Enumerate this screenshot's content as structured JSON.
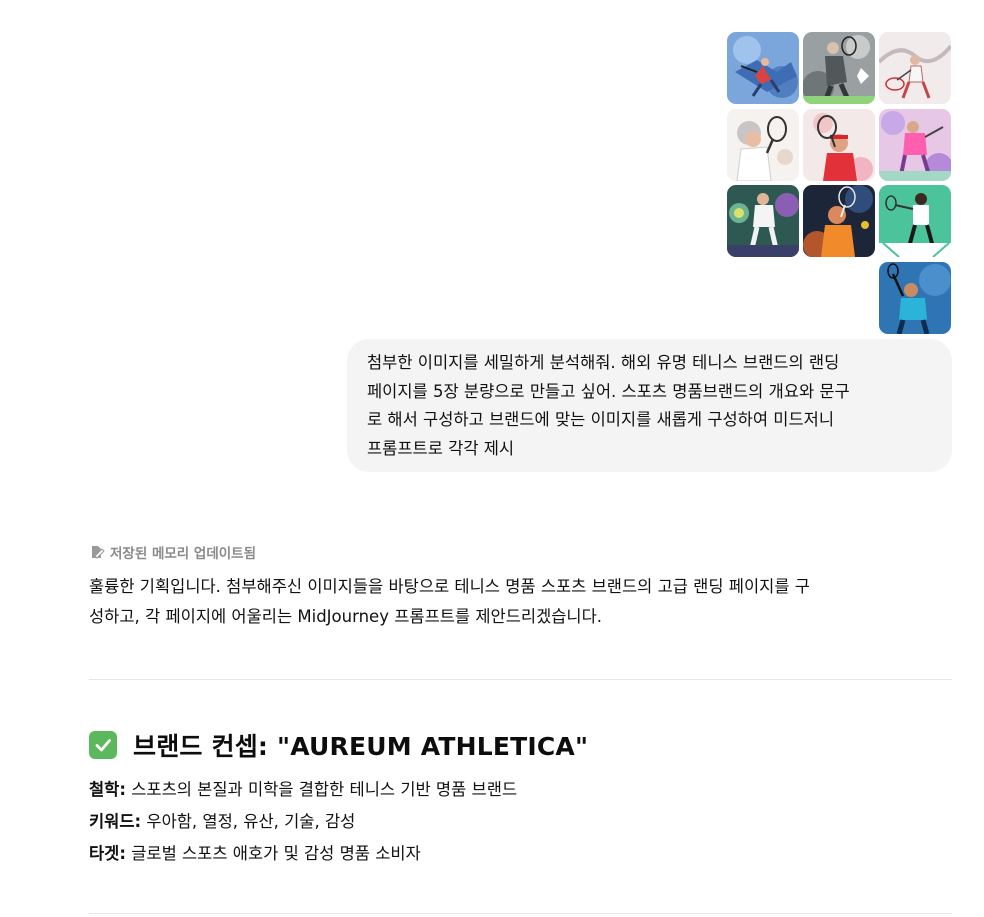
{
  "chat": {
    "user_images": [
      {
        "name": "tennis-collage-blue-smash",
        "bg": "#6d9ad4"
      },
      {
        "name": "tennis-grey-sketch-logo",
        "bg": "#8a8f91"
      },
      {
        "name": "tennis-pencil-sketch-red",
        "bg": "#ece5e6"
      },
      {
        "name": "tennis-watercolor-white-cap",
        "bg": "#f3efec"
      },
      {
        "name": "tennis-watercolor-red-headband",
        "bg": "#f0e7e6"
      },
      {
        "name": "tennis-watercolor-pink-purple",
        "bg": "#e7cbe6"
      },
      {
        "name": "tennis-dark-green-painting",
        "bg": "#2f5a52"
      },
      {
        "name": "tennis-navy-orange-painting",
        "bg": "#1f2a3d"
      },
      {
        "name": "tennis-mint-court-player",
        "bg": "#49c39a"
      },
      {
        "name": "tennis-blue-serve-photo",
        "bg": "#2d6fae"
      }
    ],
    "user_message": {
      "lines": [
        "첨부한 이미지를 세밀하게 분석해줘. 해외 유명 테니스 브랜드의 랜딩",
        "페이지를 5장 분량으로 만들고 싶어. 스포츠 명품브랜드의 개요와 문구",
        "로 해서 구성하고 브랜드에 맞는 이미지를 새롭게 구성하여 미드저니",
        "프롬프트로 각각 제시"
      ]
    },
    "memory_notice": "저장된 메모리 업데이트됨",
    "assistant_intro": {
      "line1": "훌륭한 기획입니다. 첨부해주신 이미지들을 바탕으로 테니스 명품 스포츠 브랜드의 고급 랜딩 페이지를 구",
      "line2": "성하고, 각 페이지에 어울리는 MidJourney 프롬프트를 제안드리겠습니다."
    },
    "concept": {
      "heading": "브랜드 컨셉: \"AUREUM ATHLETICA\"",
      "items": [
        {
          "label": "철학:",
          "value": " 스포츠의 본질과 미학을 결합한 테니스 기반 명품 브랜드"
        },
        {
          "label": "키워드:",
          "value": " 우아함, 열정, 유산, 기술, 감성"
        },
        {
          "label": "타겟:",
          "value": " 글로벌 스포츠 애호가 및 감성 명품 소비자"
        }
      ]
    }
  }
}
